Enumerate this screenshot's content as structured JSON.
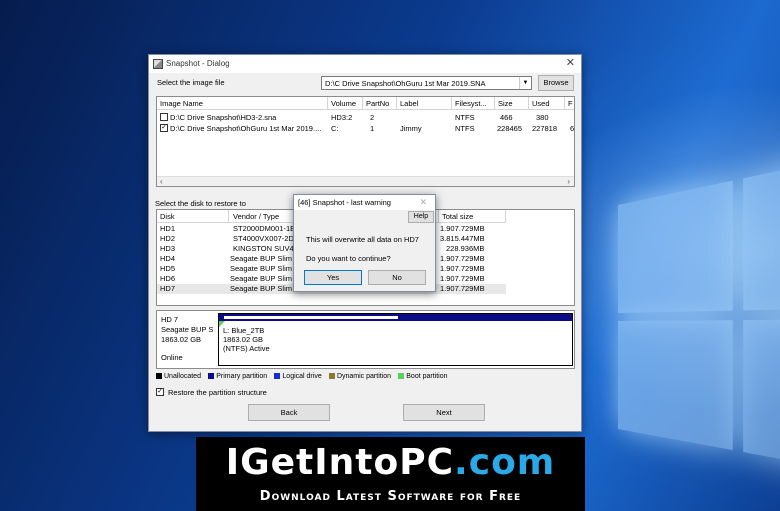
{
  "dialog": {
    "title": "Snapshot - Dialog",
    "select_image_label": "Select the image file",
    "image_path": "D:\\C Drive Snapshot\\OhGuru 1st Mar 2019.SNA",
    "browse_label": "Browse",
    "image_columns": [
      "Image Name",
      "Volume",
      "PartNo",
      "Label",
      "Filesyst...",
      "Size",
      "Used",
      "F"
    ],
    "image_rows": [
      {
        "checked": false,
        "check": "",
        "name": "D:\\C Drive Snapshot\\HD3-2.sna",
        "volume": "HD3:2",
        "partno": "2",
        "label": "",
        "fs": "NTFS",
        "size": "466",
        "used": "380",
        "extra": ""
      },
      {
        "checked": true,
        "check": "✓",
        "name": "D:\\C Drive Snapshot\\OhGuru 1st Mar 2019....",
        "volume": "C:",
        "partno": "1",
        "label": "Jimmy",
        "fs": "NTFS",
        "size": "228465",
        "used": "227818",
        "extra": "6"
      }
    ],
    "select_disk_label": "Select the disk to restore to",
    "disk_columns": [
      "Disk",
      "Vendor / Type",
      "Total size"
    ],
    "disk_rows": [
      {
        "disk": "HD1",
        "vendor": "ST2000DM001-1ER",
        "size": "1.907.729MB"
      },
      {
        "disk": "HD2",
        "vendor": "ST4000VX007-2DT",
        "size": "3.815.447MB"
      },
      {
        "disk": "HD3",
        "vendor": "KINGSTON SUV400",
        "size": "228.936MB"
      },
      {
        "disk": "HD4",
        "vendor": "Seagate  BUP Slim B",
        "size": "1.907.729MB"
      },
      {
        "disk": "HD5",
        "vendor": "Seagate  BUP Slim B",
        "size": "1.907.729MB"
      },
      {
        "disk": "HD6",
        "vendor": "Seagate  BUP Slim B",
        "size": "1.907.729MB"
      },
      {
        "disk": "HD7",
        "vendor": "Seagate  BUP Slim B",
        "size": "1.907.729MB"
      }
    ],
    "partition": {
      "disk_name": "HD 7",
      "disk_vendor": "Seagate  BUP S",
      "disk_size": "1863.02 GB",
      "disk_status": "Online",
      "part_label": "L: Blue_2TB",
      "part_size": "1863.02 GB",
      "part_fs": "(NTFS) Active"
    },
    "legend": [
      {
        "label": "Unallocated",
        "color": "#000000"
      },
      {
        "label": "Primary partition",
        "color": "#0c0c86"
      },
      {
        "label": "Logical drive",
        "color": "#1a2bd0"
      },
      {
        "label": "Dynamic partition",
        "color": "#8a7a2a"
      },
      {
        "label": "Boot partition",
        "color": "#5ad25a"
      }
    ],
    "restore_structure_label": "Restore the partition structure",
    "restore_check": "✓",
    "back_label": "Back",
    "next_label": "Next"
  },
  "warning": {
    "title": "[46] Snapshot - last warning",
    "help_label": "Help",
    "message": "This will overwrite all data on HD7",
    "question": "Do you want to continue?",
    "yes_label": "Yes",
    "no_label": "No"
  },
  "banner": {
    "part1": "IGetInto",
    "part2": "PC",
    "part3": ".com",
    "subtitle": "Download Latest Software for Free"
  }
}
